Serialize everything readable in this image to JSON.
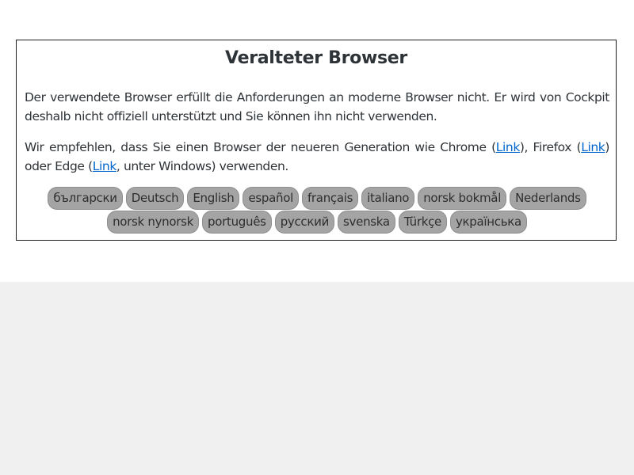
{
  "notice": {
    "title": "Veralteter Browser",
    "paragraph1": "Der verwendete Browser erfüllt die Anforderungen an moderne Browser nicht. Er wird von Cockpit deshalb nicht offiziell unterstützt und Sie können ihn nicht verwenden.",
    "p2_text1": "Wir empfehlen, dass Sie einen Browser der neueren Generation wie Chrome (",
    "chrome_link": "Link",
    "p2_text2": "), Firefox (",
    "firefox_link": "Link",
    "p2_text3": ") oder Edge (",
    "edge_link": "Link",
    "p2_text4": ", unter Windows) verwenden."
  },
  "languages": [
    "български",
    "Deutsch",
    "English",
    "español",
    "français",
    "italiano",
    "norsk bokmål",
    "Nederlands",
    "norsk nynorsk",
    "português",
    "русский",
    "svenska",
    "Türkçe",
    "українська"
  ],
  "colors": {
    "link": "#0066cc",
    "language_button_bg": "#a4a4a4",
    "page_bg_lower": "#f0f0f1"
  }
}
